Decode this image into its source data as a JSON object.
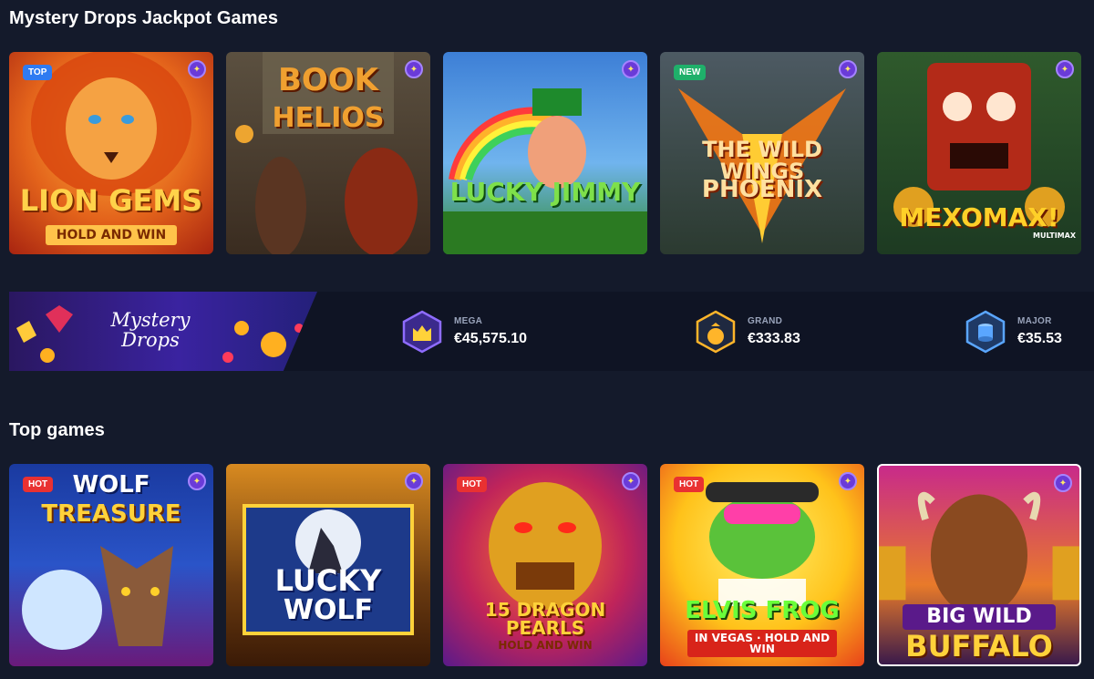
{
  "sections": {
    "mystery_title": "Mystery Drops Jackpot Games",
    "top_title": "Top games"
  },
  "mystery_games": [
    {
      "name": "Lion Gems",
      "line1": "LION GEMS",
      "line2": "HOLD AND WIN",
      "badge": "TOP"
    },
    {
      "name": "Book of Helios",
      "line1": "BOOK",
      "line2": "HELIOS",
      "badge": ""
    },
    {
      "name": "Lucky Jimmy",
      "line1": "LUCKY JIMMY",
      "line2": "",
      "badge": ""
    },
    {
      "name": "The Wild Wings of Phoenix",
      "line1": "THE WILD WINGS",
      "line2": "PHOENIX",
      "badge": "NEW"
    },
    {
      "name": "Mexomax!",
      "line1": "MEXOMAX!",
      "line2": "MULTIMAX",
      "badge": ""
    }
  ],
  "jackpot": {
    "logo_line1": "Mystery",
    "logo_line2": "Drops",
    "mega_label": "MEGA",
    "mega_amount": "€45,575.10",
    "grand_label": "GRAND",
    "grand_amount": "€333.83",
    "major_label": "MAJOR",
    "major_amount": "€35.53"
  },
  "top_games": [
    {
      "name": "Wolf Treasure",
      "line1": "WOLF",
      "line2": "TREASURE",
      "badge": "HOT"
    },
    {
      "name": "Lucky Wolf",
      "line1": "LUCKY",
      "line2": "WOLF",
      "badge": ""
    },
    {
      "name": "15 Dragon Pearls",
      "line1": "15 DRAGON PEARLS",
      "line2": "HOLD AND WIN",
      "badge": "HOT"
    },
    {
      "name": "Elvis Frog in Vegas",
      "line1": "ELVIS FROG",
      "line2": "IN VEGAS · HOLD AND WIN",
      "badge": "HOT"
    },
    {
      "name": "Big Wild Buffalo",
      "line1": "BIG WILD",
      "line2": "BUFFALO",
      "badge": ""
    }
  ],
  "colors": {
    "background": "#141a2b",
    "strip": "#0f1424",
    "badge_top": "#2f7bf1",
    "badge_new": "#1fb06a",
    "badge_hot": "#e93131",
    "favorite": "#6a3bd8"
  },
  "icons": {
    "favorite": "star-icon",
    "mega": "crown-icon",
    "grand": "money-bag-icon",
    "major": "coin-stack-icon"
  }
}
